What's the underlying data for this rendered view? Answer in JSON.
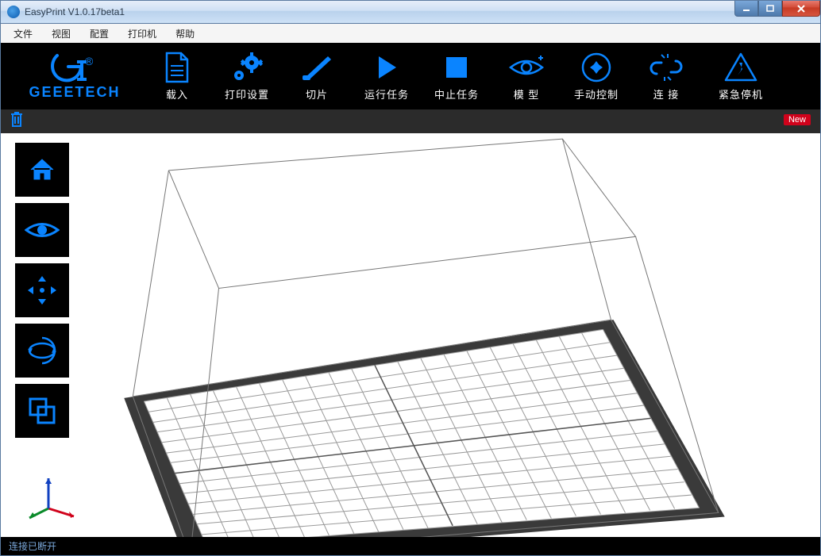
{
  "window": {
    "title": "EasyPrint   V1.0.17beta1"
  },
  "menu": {
    "items": [
      "文件",
      "视图",
      "配置",
      "打印机",
      "帮助"
    ]
  },
  "logo": {
    "text": "GEEETECH"
  },
  "toolbar": {
    "load": "载入",
    "print_settings": "打印设置",
    "slice": "切片",
    "run_task": "运行任务",
    "stop_task": "中止任务",
    "model": "模 型",
    "manual_control": "手动控制",
    "connect": "连 接",
    "emergency_stop": "紧急停机"
  },
  "badge": {
    "new": "New"
  },
  "status": {
    "text": "连接已断开"
  },
  "colors": {
    "accent": "#0a84ff",
    "danger": "#d0021b"
  }
}
